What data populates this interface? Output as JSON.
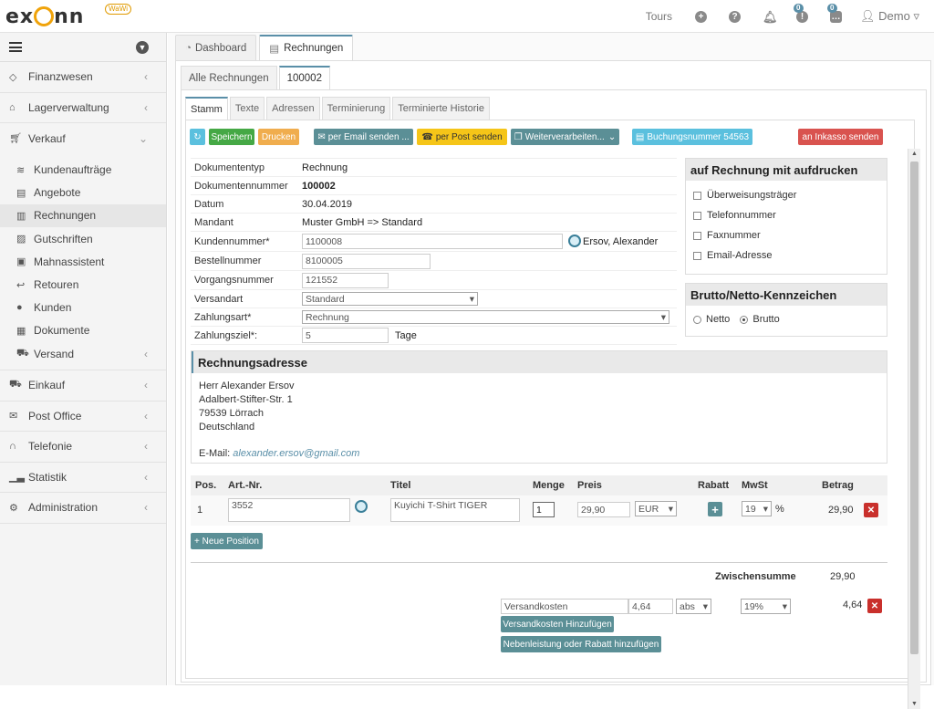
{
  "app": {
    "logo": "exonn",
    "logo_badge": "WaWi"
  },
  "topbar": {
    "tours": "Tours",
    "badge1": "0",
    "badge2": "0",
    "user": "Demo"
  },
  "sidebar": {
    "items": [
      {
        "label": "Finanzwesen",
        "icon": "finance-icon"
      },
      {
        "label": "Lagerverwaltung",
        "icon": "warehouse-icon"
      },
      {
        "label": "Verkauf",
        "icon": "cart-icon"
      }
    ],
    "sub": [
      {
        "label": "Kundenaufträge"
      },
      {
        "label": "Angebote"
      },
      {
        "label": "Rechnungen"
      },
      {
        "label": "Gutschriften"
      },
      {
        "label": "Mahnassistent"
      },
      {
        "label": "Retouren"
      },
      {
        "label": "Kunden"
      },
      {
        "label": "Dokumente"
      },
      {
        "label": "Versand"
      }
    ],
    "bottom": [
      {
        "label": "Einkauf"
      },
      {
        "label": "Post Office"
      },
      {
        "label": "Telefonie"
      },
      {
        "label": "Statistik"
      },
      {
        "label": "Administration"
      }
    ]
  },
  "tabs": {
    "dashboard": "Dashboard",
    "rechnungen": "Rechnungen",
    "alle": "Alle Rechnungen",
    "doc": "100002",
    "inner": [
      "Stamm",
      "Texte",
      "Adressen",
      "Terminierung",
      "Terminierte Historie"
    ]
  },
  "toolbar": {
    "save": "Speichern",
    "print": "Drucken",
    "email": "per Email senden ...",
    "post": "per Post senden",
    "weiter": "Weiterverarbeiten...",
    "buchung": "Buchungsnummer 54563",
    "inkasso": "an Inkasso senden"
  },
  "form": {
    "dokumententyp_l": "Dokumententyp",
    "dokumententyp": "Rechnung",
    "dokumentennummer_l": "Dokumentennummer",
    "dokumentennummer": "100002",
    "datum_l": "Datum",
    "datum": "30.04.2019",
    "mandant_l": "Mandant",
    "mandant": "Muster GmbH => Standard",
    "kunde_l": "Kundennummer*",
    "kunde": "1100008",
    "kunde_name": "Ersov, Alexander",
    "bestell_l": "Bestellnummer",
    "bestell": "8100005",
    "vorgang_l": "Vorgangsnummer",
    "vorgang": "121552",
    "versand_l": "Versandart",
    "versand": "Standard",
    "zahlart_l": "Zahlungsart*",
    "zahlart": "Rechnung",
    "ziel_l": "Zahlungsziel*:",
    "ziel": "5",
    "ziel_unit": "Tage"
  },
  "print_options": {
    "title": "auf Rechnung mit aufdrucken",
    "items": [
      "Überweisungsträger",
      "Telefonnummer",
      "Faxnummer",
      "Email-Adresse"
    ]
  },
  "brutto": {
    "title": "Brutto/Netto-Kennzeichen",
    "netto": "Netto",
    "brutto": "Brutto"
  },
  "address": {
    "title": "Rechnungsadresse",
    "lines": [
      "Herr Alexander Ersov",
      "Adalbert-Stifter-Str. 1",
      "79539 Lörrach",
      "Deutschland"
    ],
    "email_label": "E-Mail:",
    "email": "alexander.ersov@gmail.com"
  },
  "positions": {
    "headers": [
      "Pos.",
      "Art.-Nr.",
      "Titel",
      "Menge",
      "Preis",
      "Rabatt",
      "MwSt",
      "Betrag"
    ],
    "rows": [
      {
        "pos": "1",
        "artnr": "3552",
        "titel": "Kuyichi T-Shirt TIGER",
        "menge": "1",
        "preis": "29,90",
        "currency": "EUR",
        "mwst": "19",
        "pct": "%",
        "betrag": "29,90"
      }
    ],
    "add": "+ Neue Position"
  },
  "totals": {
    "zwischensumme_l": "Zwischensumme",
    "zwischensumme": "29,90",
    "versandkosten": "Versandkosten",
    "vk_value": "4,64",
    "vk_type": "abs",
    "vk_tax": "19%",
    "vk_betrag": "4,64",
    "add_vk": "Versandkosten Hinzufügen",
    "add_neben": "Nebenleistung oder Rabatt hinzufügen"
  },
  "colors": {
    "accent": "#5a8fa8",
    "red": "#d9534f",
    "green": "#45a845"
  }
}
